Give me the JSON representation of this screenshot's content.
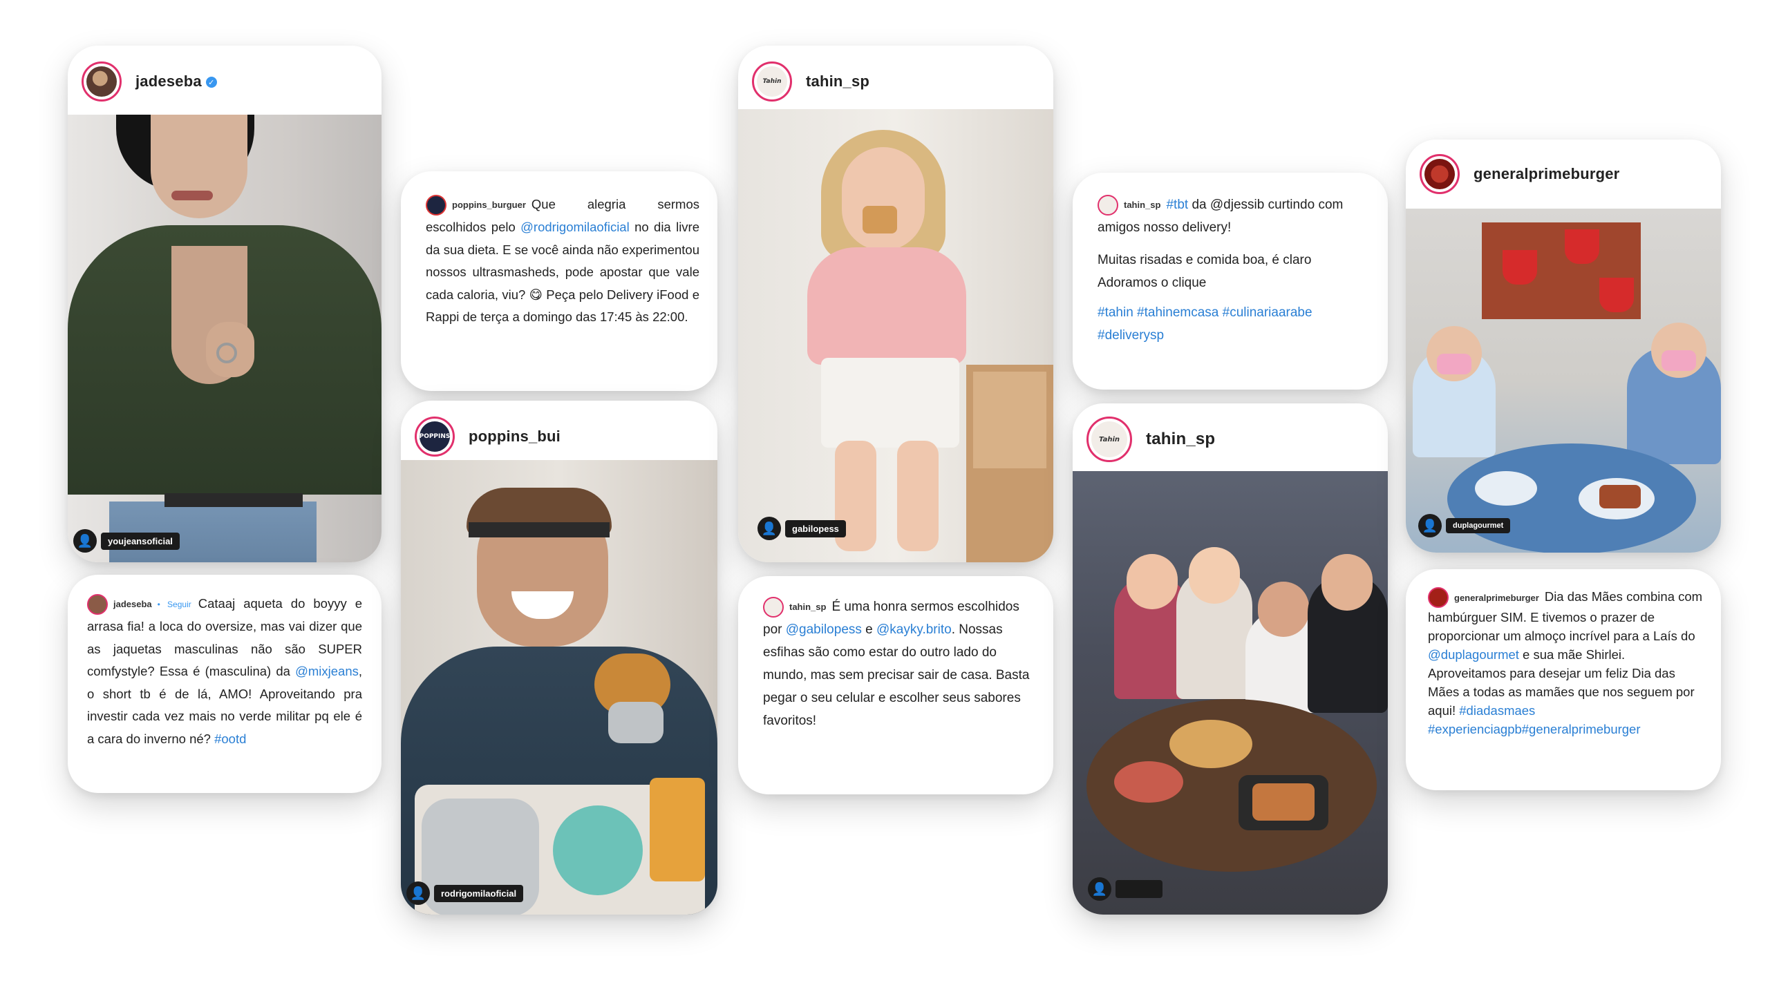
{
  "colors": {
    "link": "#2a7fd4",
    "ring": "#e1306c",
    "verified": "#3897f0"
  },
  "cards": {
    "jadeseba_post": {
      "username": "jadeseba",
      "tag": "youjeansoficial"
    },
    "jadeseba_caption": {
      "user": "jadeseba",
      "follow": "• Seguir",
      "t1": "Cataaj aqueta do boyyy e arrasa fia! a loca do oversize, mas vai dizer que as jaquetas masculinas não são SUPER comfystyle? Essa é (masculina) da ",
      "l1": "@mixjeans",
      "t2": ", o short tb é de lá, AMO! Aproveitando pra investir cada vez mais no verde militar pq ele é a cara do inverno né? ",
      "l2": "#ootd"
    },
    "poppins_caption": {
      "user": "poppins_burguer",
      "t1": "Que alegria sermos escolhidos pelo ",
      "l1": "@rodrigomilaoficial",
      "t2": " no dia livre da sua dieta. E se você ainda não experimentou nossos ultrasmasheds, pode apostar que vale cada caloria, viu? 😋 Peça pelo Delivery iFood e Rappi de terça a domingo das 17:45 às 22:00."
    },
    "poppins_post": {
      "username": "poppins_bui",
      "tag": "rodrigomilaoficial",
      "avatar_text": "POPPINS"
    },
    "tahin_post1": {
      "username": "tahin_sp",
      "tag": "gabilopess",
      "avatar_text": "Tahin"
    },
    "tahin_caption2": {
      "user": "tahin_sp",
      "t1": "É uma honra sermos escolhidos por ",
      "l1": "@gabilopess",
      "t2": " e ",
      "l2": "@kayky.brito",
      "t3": ". Nossas esfihas são como estar do outro lado do mundo, mas sem precisar sair de casa. Basta pegar o seu celular e escolher seus sabores favoritos!"
    },
    "tahin_caption1": {
      "user": "tahin_sp",
      "l1": "#tbt",
      "t1": " da @djessib curtindo com amigos nosso delivery!",
      "p2": "Muitas risadas e comida boa, é claro Adoramos o clique",
      "tags": "#tahin #tahinemcasa #culinariaarabe #deliverysp"
    },
    "tahin_post2": {
      "username": "tahin_sp",
      "avatar_text": "Tahin"
    },
    "general_post": {
      "username": "generalprimeburger",
      "tag": "duplagourmet"
    },
    "general_caption": {
      "user": "generalprimeburger",
      "t1": "Dia das Mães combina com hambúrguer SIM. E tivemos o prazer de proporcionar um almoço incrível para a Laís do ",
      "l1": "@duplagourmet",
      "t2": " e sua mãe Shirlei.",
      "t3": "Aproveitamos para desejar um feliz Dia das Mães a todas as mamães que nos seguem por aqui! ",
      "l2": "#diadasmaes #experienciagpb#generalprimeburger"
    }
  }
}
